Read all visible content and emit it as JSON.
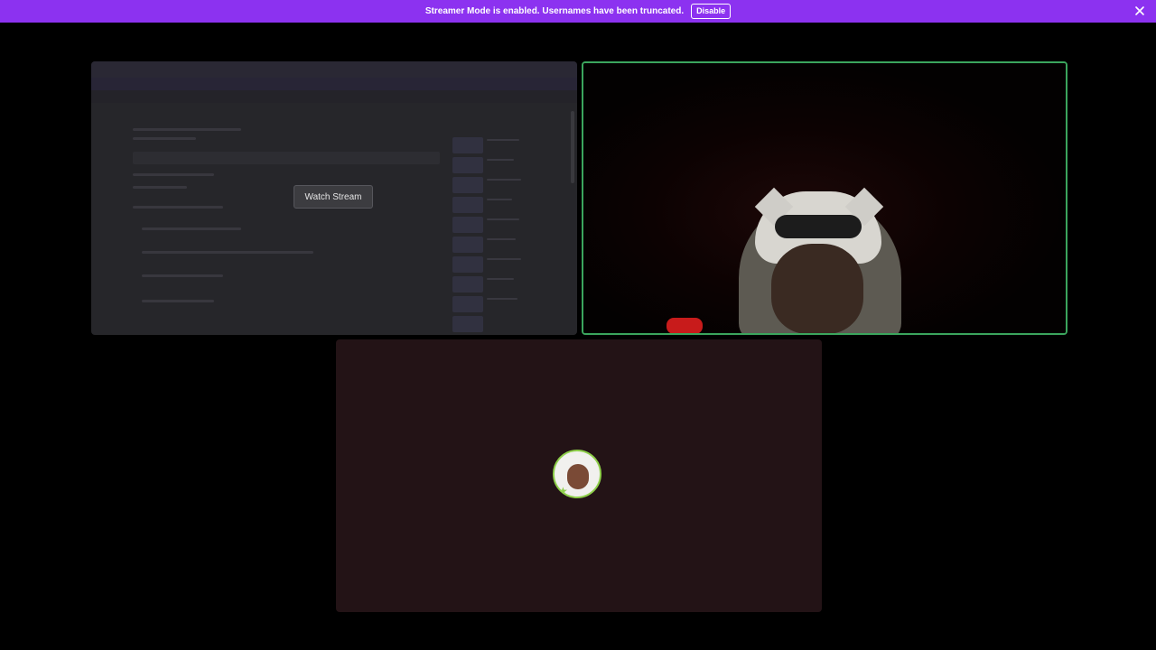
{
  "banner": {
    "text": "Streamer Mode is enabled. Usernames have been truncated.",
    "disable_label": "Disable",
    "close_icon": "close-icon",
    "color": "#8c32f0"
  },
  "stream_tile": {
    "watch_label": "Watch Stream"
  },
  "camera_tile": {
    "speaking_border_color": "#3ba55d"
  },
  "voice_tile": {
    "background": "#231316",
    "avatar_icon": "user-avatar"
  }
}
